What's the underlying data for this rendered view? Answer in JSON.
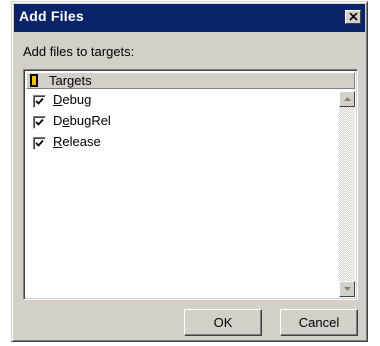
{
  "window": {
    "title": "Add Files",
    "close_glyph": "×"
  },
  "prompt": "Add files to targets:",
  "list": {
    "header": "Targets",
    "items": [
      {
        "pre": "",
        "accel": "D",
        "post": "ebug",
        "checked": true
      },
      {
        "pre": "D",
        "accel": "e",
        "post": "bugRel",
        "checked": true
      },
      {
        "pre": "",
        "accel": "R",
        "post": "elease",
        "checked": true
      }
    ]
  },
  "buttons": {
    "ok": "OK",
    "cancel": "Cancel"
  },
  "colors": {
    "titlebar": "#0a246a",
    "dialog_face": "#d4d0c8"
  }
}
